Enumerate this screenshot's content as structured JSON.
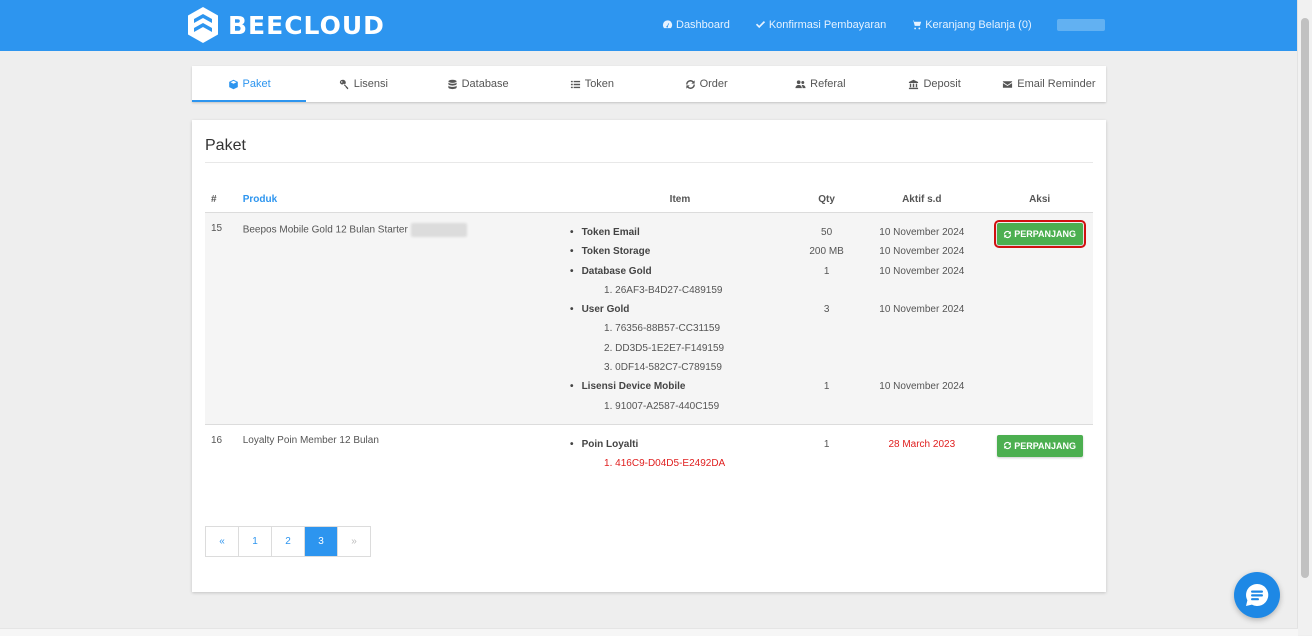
{
  "app": {
    "logo_text": "BEECLOUD"
  },
  "nav": {
    "links": [
      {
        "label": "Dashboard",
        "icon": "dashboard-icon"
      },
      {
        "label": "Konfirmasi Pembayaran",
        "icon": "check-icon"
      },
      {
        "label": "Keranjang Belanja (0)",
        "icon": "cart-icon"
      }
    ]
  },
  "tabs": [
    {
      "label": "Paket",
      "icon": "cube-icon",
      "active": true
    },
    {
      "label": "Lisensi",
      "icon": "key-icon"
    },
    {
      "label": "Database",
      "icon": "database-icon"
    },
    {
      "label": "Token",
      "icon": "list-icon"
    },
    {
      "label": "Order",
      "icon": "refresh-icon"
    },
    {
      "label": "Referal",
      "icon": "users-icon"
    },
    {
      "label": "Deposit",
      "icon": "bank-icon"
    },
    {
      "label": "Email Reminder",
      "icon": "envelope-icon"
    }
  ],
  "panel": {
    "title": "Paket",
    "columns": {
      "num": "#",
      "produk": "Produk",
      "item": "Item",
      "qty": "Qty",
      "aktif": "Aktif s.d",
      "aksi": "Aksi"
    },
    "rows": [
      {
        "num": "15",
        "produk": "Beepos Mobile Gold 12 Bulan Starter",
        "items": [
          {
            "name": "Token Email",
            "qty": "50",
            "date": "10 November 2024",
            "subs": []
          },
          {
            "name": "Token Storage",
            "qty": "200 MB",
            "date": "10 November 2024",
            "subs": []
          },
          {
            "name": "Database Gold",
            "qty": "1",
            "date": "10 November 2024",
            "subs": [
              "1. 26AF3-B4D27-C489159"
            ]
          },
          {
            "name": "User Gold",
            "qty": "3",
            "date": "10 November 2024",
            "subs": [
              "1. 76356-88B57-CC31159",
              "2. DD3D5-1E2E7-F149159",
              "3. 0DF14-582C7-C789159"
            ]
          },
          {
            "name": "Lisensi Device Mobile",
            "qty": "1",
            "date": "10 November 2024",
            "subs": [
              "1. 91007-A2587-440C159"
            ]
          }
        ],
        "action": "PERPANJANG"
      },
      {
        "num": "16",
        "produk": "Loyalty Poin Member 12 Bulan",
        "items": [
          {
            "name": "Poin Loyalti",
            "qty": "1",
            "date": "28 March 2023",
            "subs": [
              "1. 416C9-D04D5-E2492DA"
            ]
          }
        ],
        "action": "PERPANJANG"
      }
    ]
  },
  "pagination": {
    "prev": "«",
    "pages": [
      "1",
      "2",
      "3"
    ],
    "active": "3",
    "next": "»"
  },
  "colors": {
    "primary": "#2d95ef",
    "success": "#4caf50",
    "danger": "#e02020",
    "highlight": "#d01010"
  }
}
